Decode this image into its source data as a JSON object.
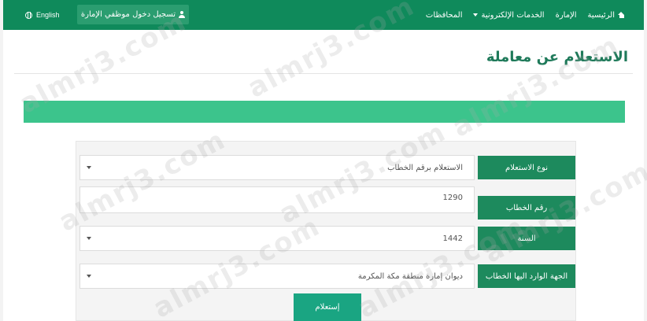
{
  "navbar": {
    "language": "English",
    "login_button": "تسجيل دخول موظفي الإمارة",
    "items": [
      {
        "label": "الرئيسية",
        "icon": "home-icon"
      },
      {
        "label": "الإمارة"
      },
      {
        "label": "الخدمات الإلكترونية",
        "icon": "caret-down-icon"
      },
      {
        "label": "المحافظات"
      }
    ]
  },
  "page": {
    "title": "الاستعلام عن معاملة"
  },
  "form": {
    "inquiry_type": {
      "label": "نوع الاستعلام",
      "value": "الاستعلام برقم الخطاب"
    },
    "letter_number": {
      "label": "رقم الخطاب",
      "value": "1290"
    },
    "year": {
      "label": "السنة",
      "value": "1442"
    },
    "incoming_entity": {
      "label": "الجهة الوارد اليها الخطاب",
      "value": "ديوان إمارة منطقة مكة المكرمة"
    },
    "submit_label": "إستعلام"
  },
  "watermark": "almrj3.com",
  "colors": {
    "navbar": "#0f8a5b",
    "accent": "#1d8a5d",
    "status_bar": "#3cc48c",
    "button": "#1aa582"
  }
}
